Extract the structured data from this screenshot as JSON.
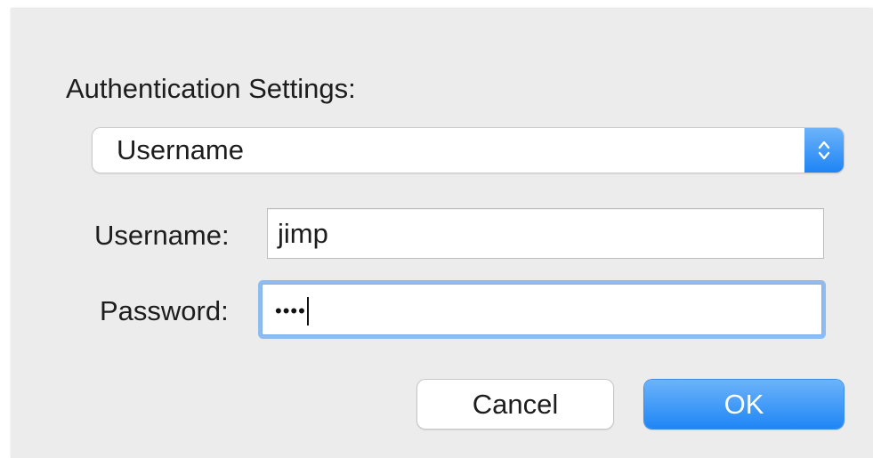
{
  "dialog": {
    "section_title": "Authentication Settings:",
    "auth_method": {
      "selected": "Username"
    },
    "username": {
      "label": "Username:",
      "value": "jimp"
    },
    "password": {
      "label": "Password:",
      "masked_value": "••••"
    },
    "buttons": {
      "cancel": "Cancel",
      "ok": "OK"
    }
  },
  "icons": {
    "popup": "updown-chevron-icon"
  },
  "colors": {
    "accent": "#1e84f5",
    "focus_ring": "#8ebcf0",
    "sheet_background": "#ececec"
  }
}
